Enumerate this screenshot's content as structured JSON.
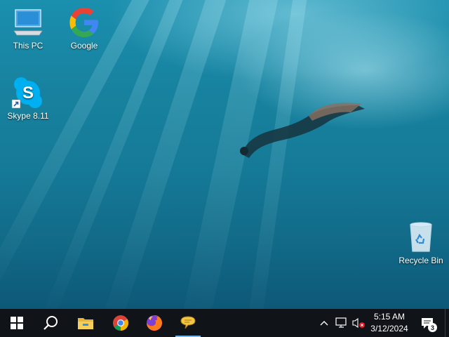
{
  "desktop": {
    "icons": [
      {
        "label": "This PC",
        "icon": "this-pc-icon"
      },
      {
        "label": "Google",
        "icon": "google-icon"
      },
      {
        "label": "Skype 8.11",
        "icon": "skype-icon"
      },
      {
        "label": "Recycle Bin",
        "icon": "recycle-bin-icon"
      }
    ]
  },
  "taskbar": {
    "buttons": [
      {
        "icon": "windows-start-icon"
      },
      {
        "icon": "search-icon"
      },
      {
        "icon": "file-explorer-icon"
      },
      {
        "icon": "chrome-icon"
      },
      {
        "icon": "firefox-icon"
      },
      {
        "icon": "chat-app-icon",
        "active": true
      }
    ],
    "tray": {
      "icons": [
        "chevron-up-icon",
        "network-icon",
        "volume-muted-icon"
      ],
      "time": "5:15 AM",
      "date": "3/12/2024",
      "notification_count": "3"
    }
  },
  "colors": {
    "taskbar_bg": "#101418",
    "accent": "#76b9ed"
  }
}
